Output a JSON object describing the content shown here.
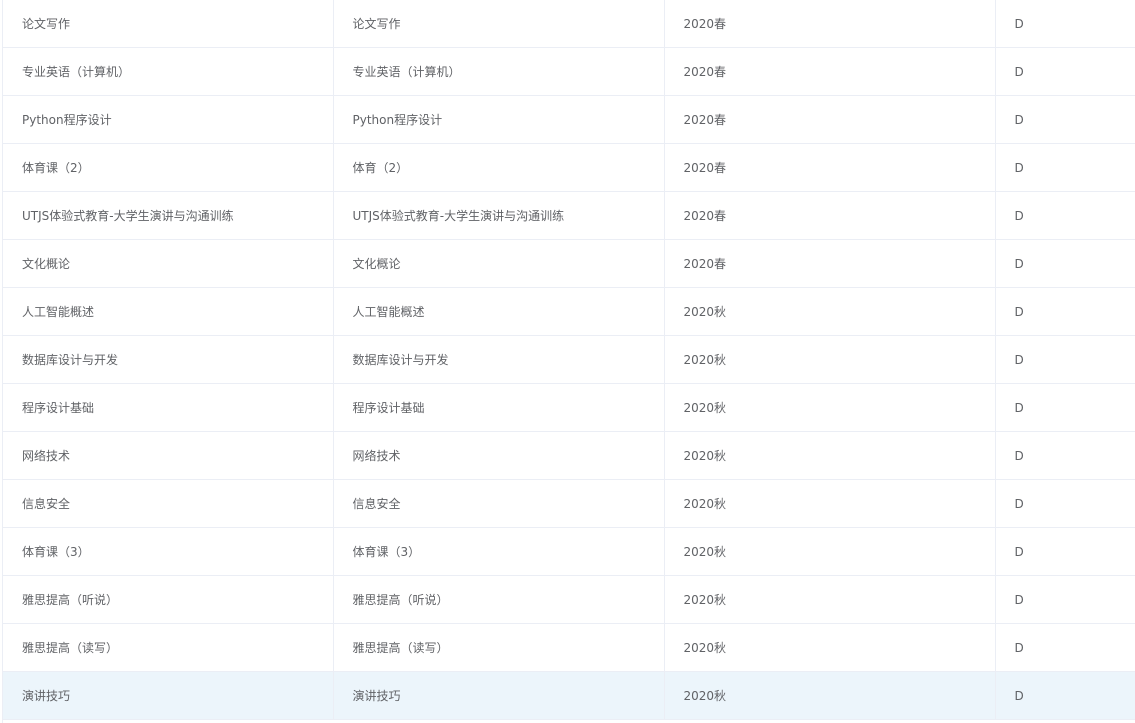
{
  "rows": [
    {
      "name": "论文写作",
      "orig_name": "论文写作",
      "term": "2020春",
      "grade": "D"
    },
    {
      "name": "专业英语（计算机）",
      "orig_name": "专业英语（计算机）",
      "term": "2020春",
      "grade": "D"
    },
    {
      "name": "Python程序设计",
      "orig_name": "Python程序设计",
      "term": "2020春",
      "grade": "D"
    },
    {
      "name": "体育课（2）",
      "orig_name": "体育（2）",
      "term": "2020春",
      "grade": "D"
    },
    {
      "name": "UTJS体验式教育-大学生演讲与沟通训练",
      "orig_name": "UTJS体验式教育-大学生演讲与沟通训练",
      "term": "2020春",
      "grade": "D"
    },
    {
      "name": "文化概论",
      "orig_name": "文化概论",
      "term": "2020春",
      "grade": "D"
    },
    {
      "name": "人工智能概述",
      "orig_name": "人工智能概述",
      "term": "2020秋",
      "grade": "D"
    },
    {
      "name": "数据库设计与开发",
      "orig_name": "数据库设计与开发",
      "term": "2020秋",
      "grade": "D"
    },
    {
      "name": "程序设计基础",
      "orig_name": "程序设计基础",
      "term": "2020秋",
      "grade": "D"
    },
    {
      "name": "网络技术",
      "orig_name": "网络技术",
      "term": "2020秋",
      "grade": "D"
    },
    {
      "name": "信息安全",
      "orig_name": "信息安全",
      "term": "2020秋",
      "grade": "D"
    },
    {
      "name": "体育课（3）",
      "orig_name": "体育课（3）",
      "term": "2020秋",
      "grade": "D"
    },
    {
      "name": "雅思提高（听说）",
      "orig_name": "雅思提高（听说）",
      "term": "2020秋",
      "grade": "D"
    },
    {
      "name": "雅思提高（读写）",
      "orig_name": "雅思提高（读写）",
      "term": "2020秋",
      "grade": "D"
    },
    {
      "name": "演讲技巧",
      "orig_name": "演讲技巧",
      "term": "2020秋",
      "grade": "D"
    }
  ],
  "highlight_row": 14,
  "colors": {
    "text": "#606266",
    "border": "#ebeef5",
    "row_hover": "#ecf5fb"
  }
}
